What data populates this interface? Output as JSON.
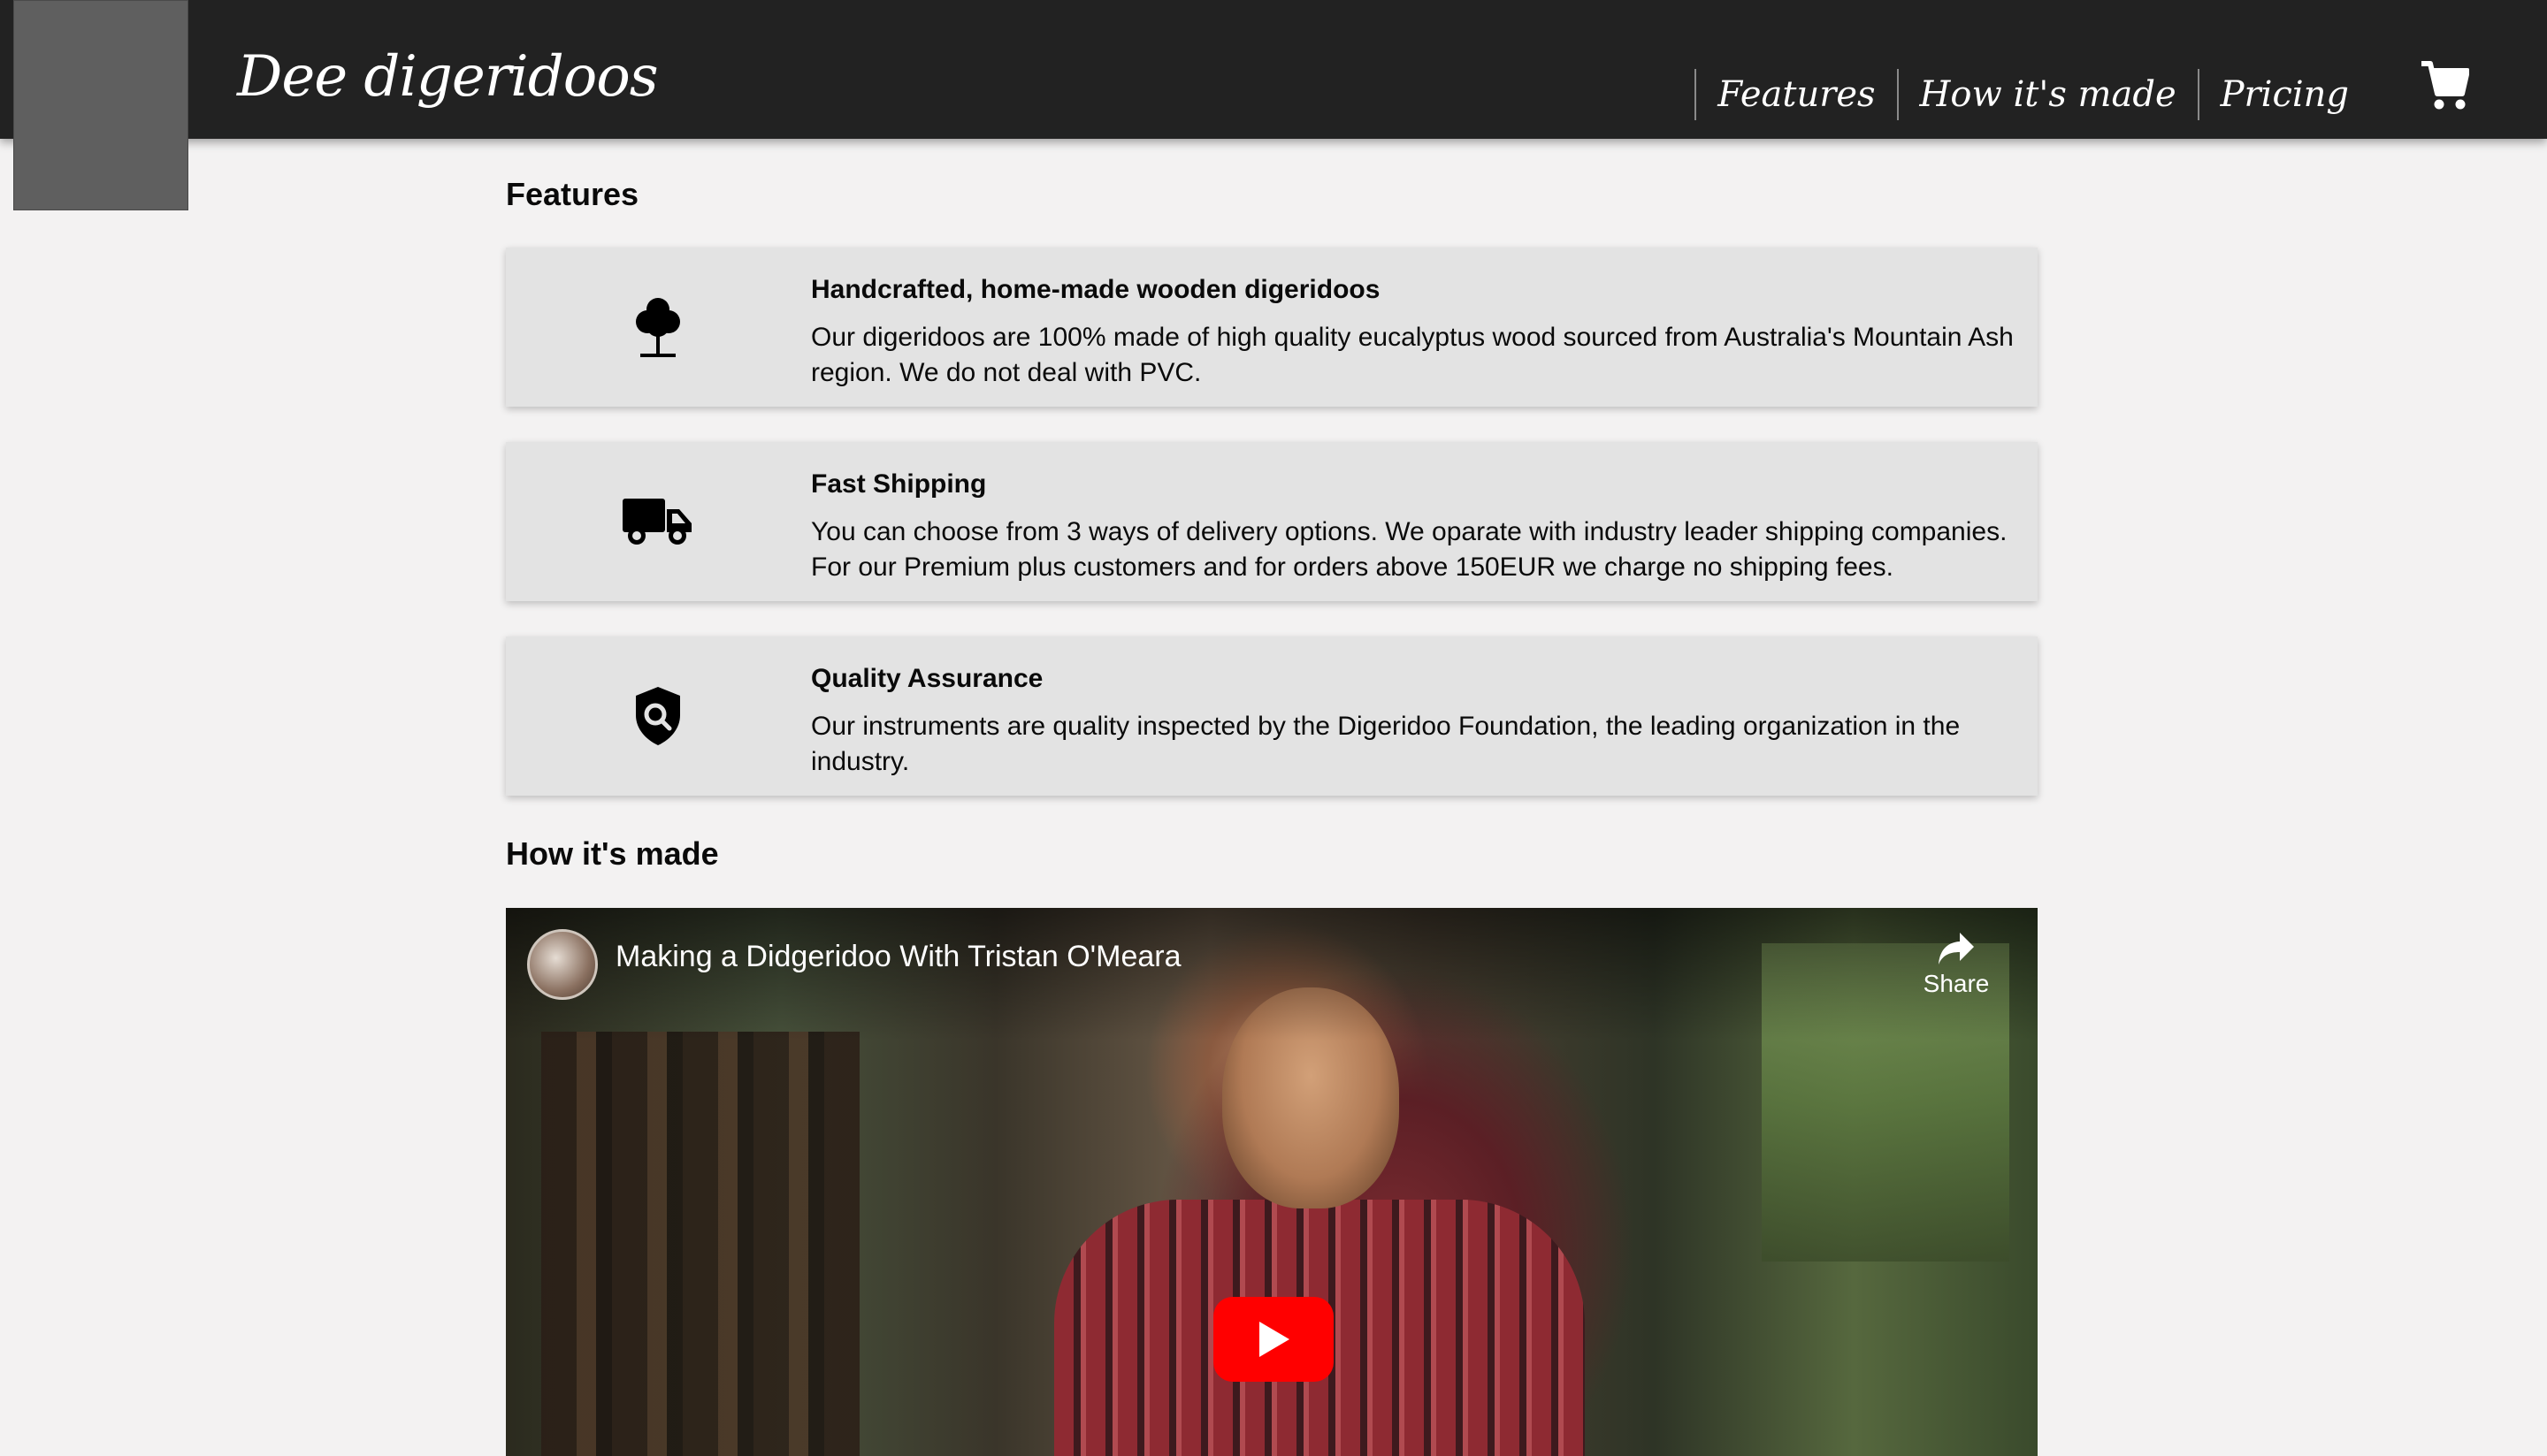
{
  "header": {
    "brand": "Dee digeridoos",
    "nav": [
      "Features",
      "How it's made",
      "Pricing"
    ],
    "cart_icon": "cart-icon"
  },
  "features": {
    "title": "Features",
    "items": [
      {
        "icon": "tree-icon",
        "heading": "Handcrafted, home-made wooden digeridoos",
        "text": "Our digeridoos are 100% made of high quality eucalyptus wood sourced from Australia's Mountain Ash region. We do not deal with PVC."
      },
      {
        "icon": "truck-icon",
        "heading": "Fast Shipping",
        "text": "You can choose from 3 ways of delivery options. We oparate with industry leader shipping companies. For our Premium plus customers and for orders above 150EUR we charge no shipping fees."
      },
      {
        "icon": "shield-search-icon",
        "heading": "Quality Assurance",
        "text": "Our instruments are quality inspected by the Digeridoo Foundation, the leading organization in the industry."
      }
    ]
  },
  "how_its_made": {
    "title": "How it's made",
    "video": {
      "title": "Making a Didgeridoo With Tristan O'Meara",
      "share_label": "Share",
      "play_color": "#ff0000"
    }
  }
}
